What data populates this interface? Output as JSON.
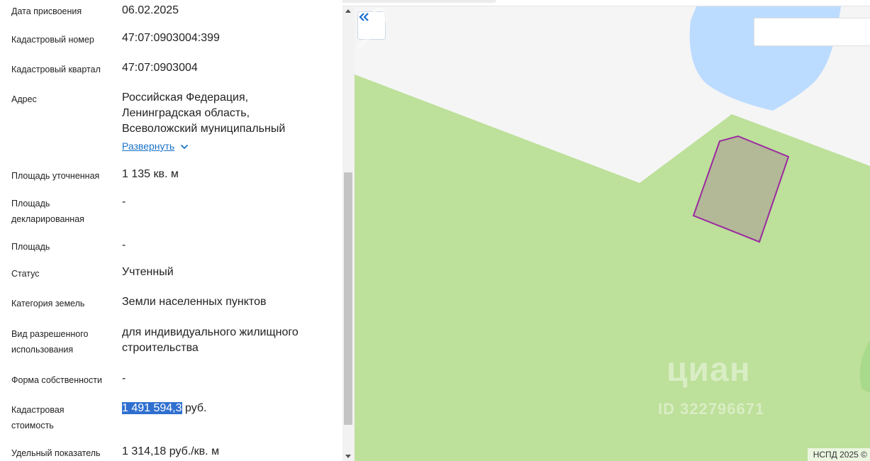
{
  "rows": [
    {
      "label": "Дата присвоения",
      "value": "06.02.2025"
    },
    {
      "label": "Кадастровый номер",
      "value": "47:07:0903004:399"
    },
    {
      "label": "Кадастровый квартал",
      "value": "47:07:0903004"
    },
    {
      "label": "Адрес",
      "value_lines": [
        "Российская Федерация,",
        "Ленинградская область,",
        "Всеволожский муниципальный"
      ],
      "expand_label": "Развернуть"
    },
    {
      "label": "Площадь уточненная",
      "value": "1 135 кв. м"
    },
    {
      "label_lines": [
        "Площадь",
        "декларированная"
      ],
      "value": "-"
    },
    {
      "label": "Площадь",
      "value": "-"
    },
    {
      "label": "Статус",
      "value": "Учтенный"
    },
    {
      "label": "Категория земель",
      "value": "Земли населенных пунктов"
    },
    {
      "label_lines": [
        "Вид разрешенного",
        "использования"
      ],
      "value_lines": [
        "для индивидуального жилищного",
        "строительства"
      ]
    },
    {
      "label": "Форма собственности",
      "value": "-"
    },
    {
      "label_lines": [
        "Кадастровая",
        "стоимость"
      ],
      "value_highlighted": "1 491 594,3",
      "value_rest": " руб."
    },
    {
      "label": "Удельный показатель",
      "value": "1 314,18 руб./кв. м"
    }
  ],
  "map": {
    "watermark": "циан",
    "watermark_id": "ID 322796671",
    "copyright": "НСПД 2025 ©",
    "colors": {
      "land": "#bde09a",
      "water": "#bcdcff",
      "parcel_fill": "#b3b897",
      "parcel_stroke": "#9b2aa0",
      "background": "#f5f5f5"
    }
  },
  "icons": {
    "collapse": "double-chevron-left-icon",
    "expand": "chevron-down-icon"
  }
}
